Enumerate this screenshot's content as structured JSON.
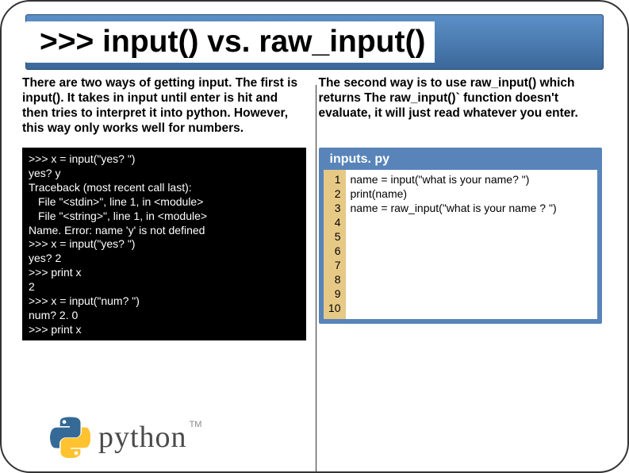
{
  "title": ">>> input() vs. raw_input()",
  "left": {
    "desc": "There are two ways of getting input. The first is input(). It takes in input until enter is hit and then tries to interpret it into python. However, this way only works well for numbers.",
    "terminal": [
      ">>> x = input(\"yes? \")",
      "yes? y",
      "Traceback (most recent call last):",
      "  File \"<stdin>\", line 1, in <module>",
      "  File \"<string>\", line 1, in <module>",
      "Name. Error: name 'y' is not defined",
      ">>> x = input(\"yes? \")",
      "yes? 2",
      ">>> print x",
      "2",
      ">>> x = input(\"num? \")",
      "num? 2. 0",
      ">>> print x"
    ]
  },
  "right": {
    "desc": "The second way is to use raw_input() which returns The raw_input()` function doesn't evaluate, it will just read whatever you enter.",
    "file": {
      "title": "inputs. py",
      "line_numbers": [
        "1",
        "2",
        "3",
        "4",
        "5",
        "6",
        "7",
        "8",
        "9",
        "10"
      ],
      "lines": [
        "name = input(\"what is your name? \")",
        "print(name)",
        "name = raw_input(\"what is your name ? \")",
        "",
        "",
        "",
        "",
        "",
        "",
        ""
      ]
    }
  },
  "logo": {
    "text": "python",
    "tm": "TM"
  }
}
